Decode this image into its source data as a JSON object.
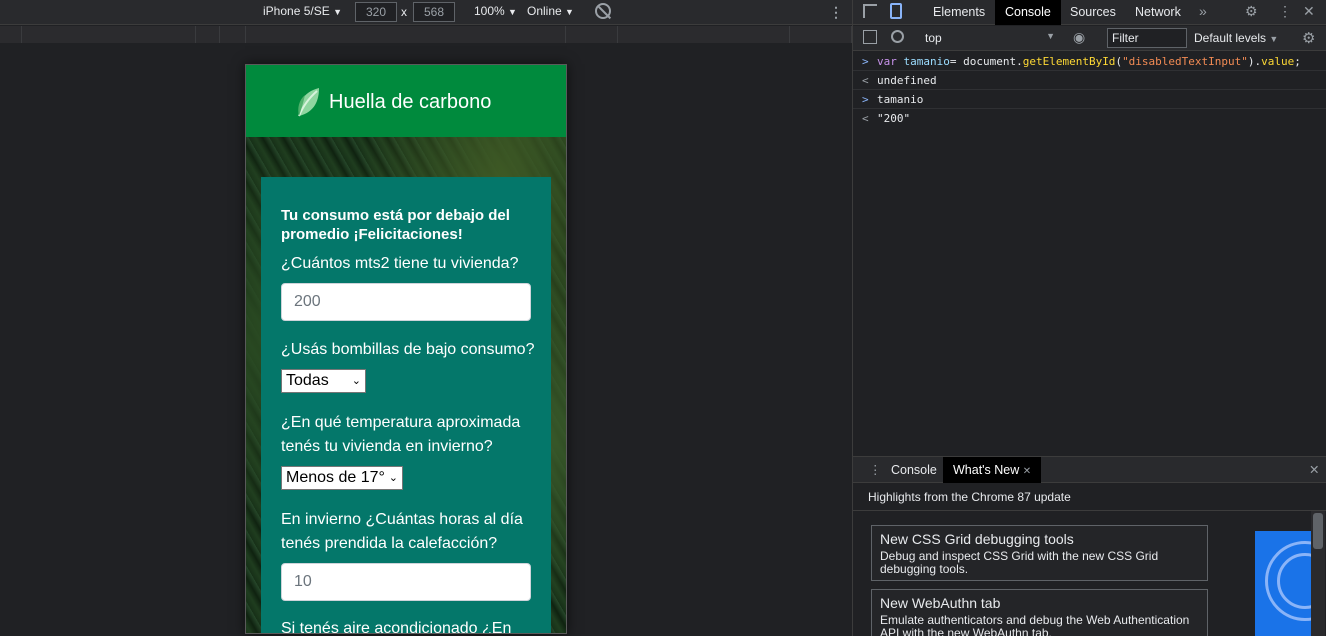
{
  "device_toolbar": {
    "device": "iPhone 5/SE",
    "width": "320",
    "height": "568",
    "times": "x",
    "zoom": "100%",
    "network": "Online",
    "caret": "▼"
  },
  "phone": {
    "brand": "Huella de carbono",
    "message": "Tu consumo está por debajo del promedio ¡Felicitaciones!",
    "q1": "¿Cuántos mts2 tiene tu vivienda?",
    "q1_value": "200",
    "q2": "¿Usás bombillas de bajo consumo?",
    "q2_value": "Todas",
    "q3": "¿En qué temperatura aproximada tenés tu vivienda en invierno?",
    "q3_value": "Menos de 17°",
    "q4": "En invierno ¿Cuántas horas al día tenés prendida la calefacción?",
    "q4_value": "10",
    "q5": "Si tenés aire acondicionado ¿En"
  },
  "devtools": {
    "tabs": [
      "Elements",
      "Console",
      "Sources",
      "Network"
    ],
    "more_tabs": "»",
    "context": "top",
    "filter_placeholder": "Filter",
    "levels": "Default levels",
    "console_lines": {
      "l1_kw": "var",
      "l1_var": "tamanio",
      "l1_eq": "= document.",
      "l1_fn": "getElementById",
      "l1_open": "(",
      "l1_str": "\"disabledTextInput\"",
      "l1_close": ").",
      "l1_prop": "value",
      "l1_end": ";",
      "l2": "undefined",
      "l3": "tamanio",
      "l4": "\"200\""
    },
    "prompt_in": ">",
    "prompt_out": "<",
    "drawer_tabs": [
      "Console",
      "What's New"
    ],
    "close": "✕",
    "highlights": "Highlights from the Chrome 87 update",
    "news": [
      {
        "title": "New CSS Grid debugging tools",
        "desc": "Debug and inspect CSS Grid with the new CSS Grid debugging tools."
      },
      {
        "title": "New WebAuthn tab",
        "desc": "Emulate authenticators and debug the Web Authentication API with the new WebAuthn tab."
      }
    ]
  }
}
